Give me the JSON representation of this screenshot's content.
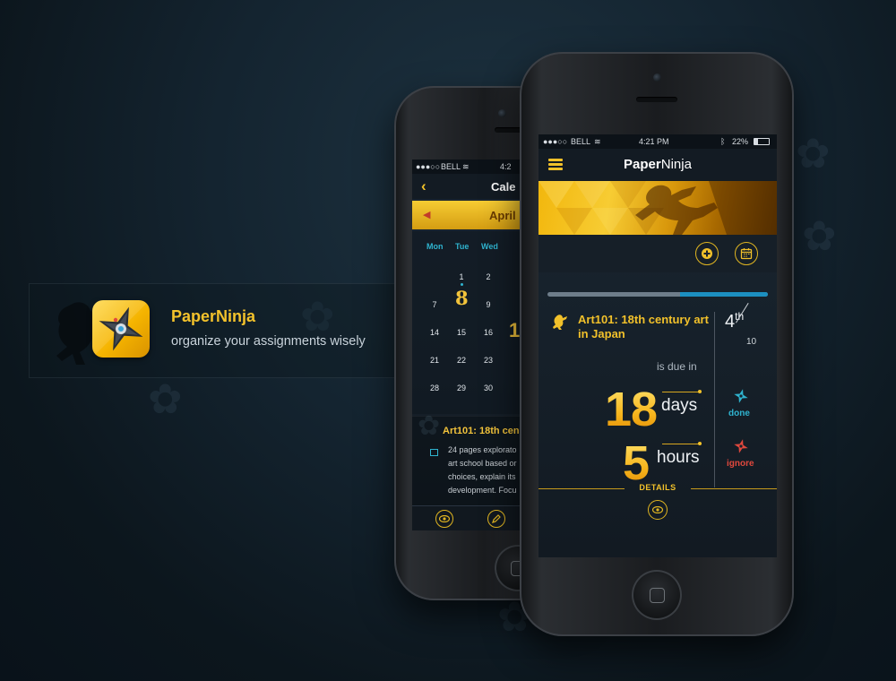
{
  "theme": {
    "accent": "#f2c12a",
    "accent_cyan": "#2fb3cf",
    "accent_red": "#e0483d",
    "background": "#142430"
  },
  "app_badge": {
    "icon": "shuriken-app-icon",
    "title": "PaperNinja",
    "subtitle": "organize your assignments wisely"
  },
  "back_phone": {
    "status": {
      "carrier": "BELL",
      "time": "4:2"
    },
    "nav": {
      "back_icon": "chevron-left-icon",
      "title": "Cale"
    },
    "month": {
      "prev_icon": "arrow-left-icon",
      "name": "April"
    },
    "weekdays": [
      "Mon",
      "Tue",
      "Wed"
    ],
    "weeks": [
      [
        "",
        "1",
        "2"
      ],
      [
        "7",
        "8",
        "9"
      ],
      [
        "14",
        "15",
        "16"
      ],
      [
        "21",
        "22",
        "23"
      ],
      [
        "28",
        "29",
        "30"
      ]
    ],
    "highlight_day": "8",
    "partial_day": "1",
    "card": {
      "title": "Art101: 18th cen",
      "lines": [
        "24 pages explorato",
        "art school based or",
        "choices, explain its",
        "development. Focu"
      ]
    },
    "toolbar": [
      "eye-icon",
      "pencil-icon"
    ]
  },
  "front_phone": {
    "status": {
      "carrier": "BELL",
      "time": "4:21 PM",
      "battery": "22%"
    },
    "nav": {
      "menu_icon": "hamburger-icon",
      "title_bold": "Paper",
      "title_regular": "Ninja"
    },
    "actions": [
      "add-icon",
      "calendar-icon"
    ],
    "progress": 0.4,
    "task": {
      "icon": "ninja-icon",
      "title": "Art101: 18th century art in Japan",
      "rank": "4",
      "rank_suffix": "th",
      "rank_total": "10",
      "due_label": "is due in",
      "days_value": "18",
      "days_unit": "days",
      "hours_value": "5",
      "hours_unit": "hours"
    },
    "status_actions": {
      "done_label": "done",
      "ignore_label": "ignore"
    },
    "details_label": "DETAILS",
    "details_icon": "eye-icon"
  }
}
